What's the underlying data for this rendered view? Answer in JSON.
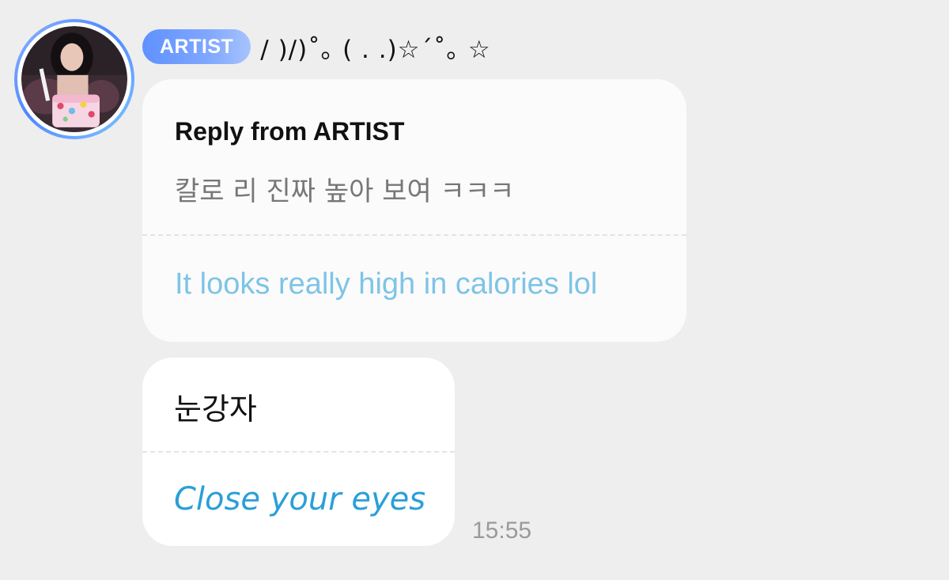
{
  "sender": {
    "badge": "ARTIST",
    "name": "/ )/)˚｡ ( . .)☆´˚｡ ☆",
    "avatar": "artist-profile-photo"
  },
  "reply": {
    "title": "Reply from ARTIST",
    "original": "칼로 리 진짜 높아 보여 ㅋㅋㅋ",
    "translation": "It looks really high in calories lol"
  },
  "message": {
    "original": "눈강자",
    "translation": "Close your eyes",
    "time": "15:55"
  },
  "colors": {
    "background": "#eeeeee",
    "bubble": "#ffffff",
    "badge_start": "#5f91ff",
    "badge_end": "#a7c3ff",
    "reply_translation": "#7ec4e6",
    "message_translation": "#2a9fd8",
    "timestamp": "#9a9a9a"
  }
}
